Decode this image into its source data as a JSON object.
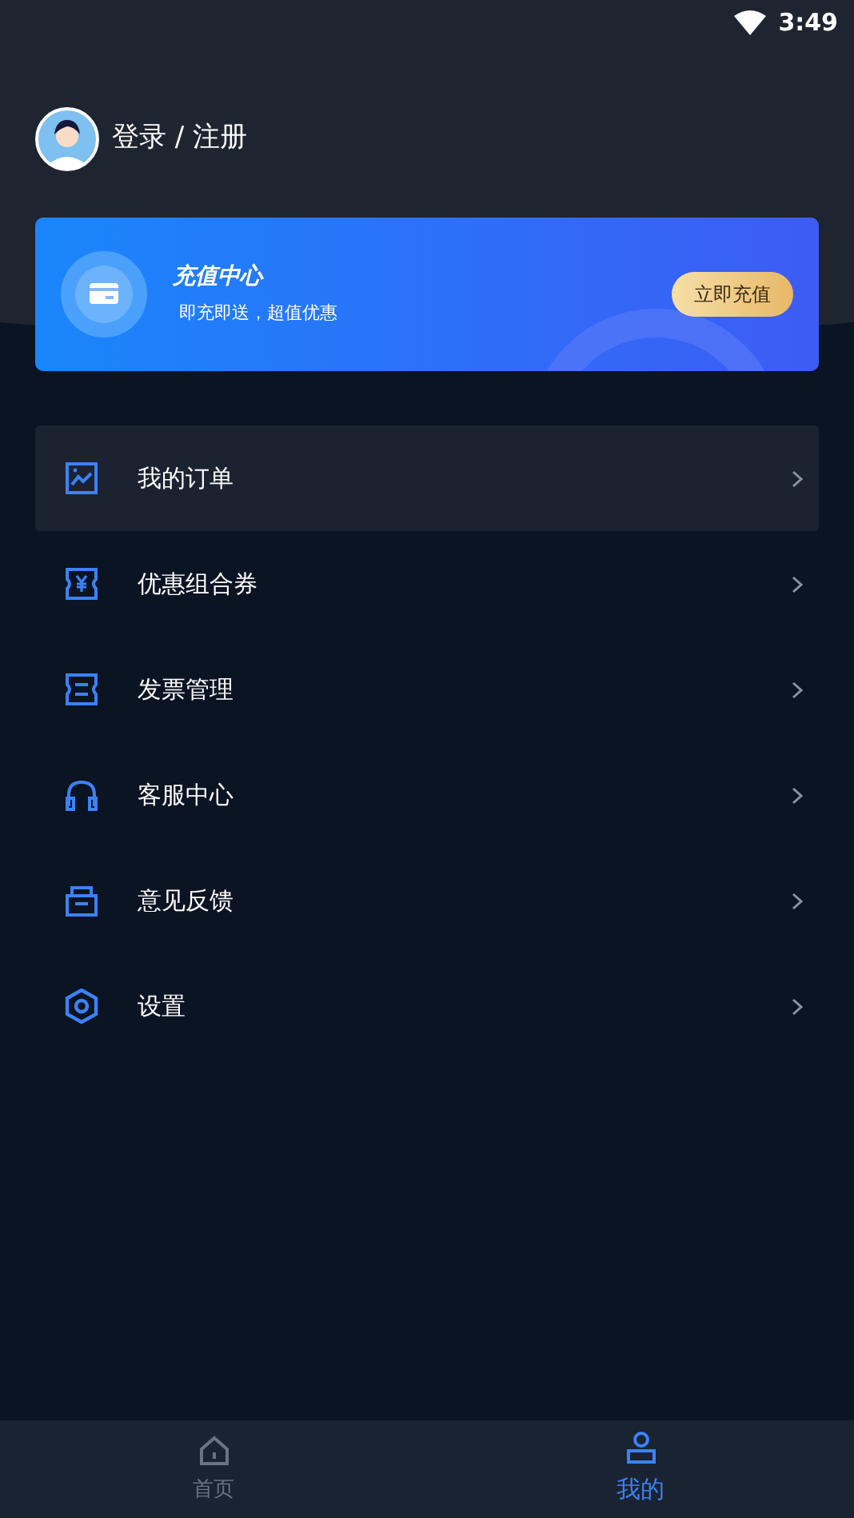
{
  "status_bar": {
    "time": "3:49"
  },
  "user": {
    "login_label": "登录 / 注册"
  },
  "recharge_banner": {
    "title": "充值中心",
    "subtitle": "即充即送，超值优惠",
    "button": "立即充值"
  },
  "menu": [
    {
      "kind": "orders",
      "label": "我的订单",
      "selected": true
    },
    {
      "kind": "coupon",
      "label": "优惠组合券",
      "selected": false
    },
    {
      "kind": "invoice",
      "label": "发票管理",
      "selected": false
    },
    {
      "kind": "service",
      "label": "客服中心",
      "selected": false
    },
    {
      "kind": "feedback",
      "label": "意见反馈",
      "selected": false
    },
    {
      "kind": "settings",
      "label": "设置",
      "selected": false
    }
  ],
  "tab_bar": [
    {
      "kind": "home",
      "label": "首页",
      "selected": false
    },
    {
      "kind": "profile",
      "label": "我的",
      "selected": true
    }
  ]
}
